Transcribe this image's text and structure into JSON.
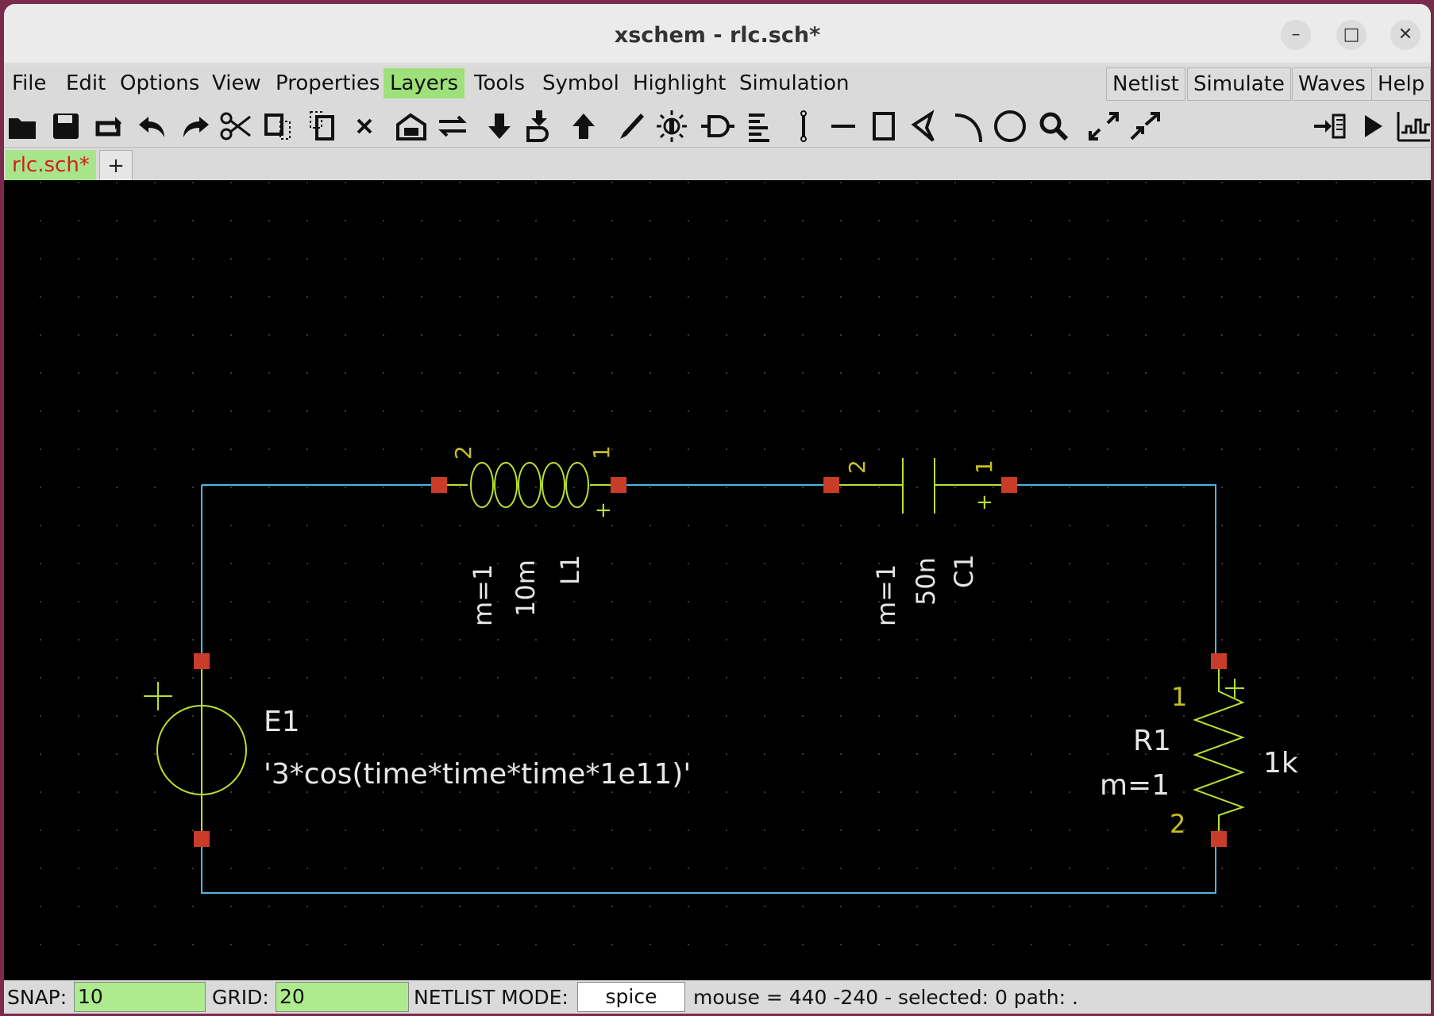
{
  "window": {
    "title": "xschem - rlc.sch*"
  },
  "menubar": {
    "items": [
      "File",
      "Edit",
      "Options",
      "View",
      "Properties",
      "Layers",
      "Tools",
      "Symbol",
      "Highlight",
      "Simulation"
    ],
    "active": "Layers",
    "right_items": [
      "Netlist",
      "Simulate",
      "Waves",
      "Help"
    ]
  },
  "toolbar": {
    "icons": [
      "open-icon",
      "save-icon",
      "reload-icon",
      "undo-icon",
      "redo-icon",
      "cut-icon",
      "copy-icon",
      "move-icon",
      "delete-icon",
      "insert-symbol-icon",
      "flip-icon",
      "descend-icon",
      "descend-symbol-icon",
      "go-up-icon",
      "draw-icon",
      "toggle-colorscheme-icon",
      "insert-pin-icon",
      "netlabel-icon",
      "wire-icon",
      "line-icon",
      "rect-icon",
      "polygon-icon",
      "arc-icon",
      "circle-icon",
      "zoom-icon",
      "zoom-in-icon",
      "zoom-out-icon",
      "netlist-icon",
      "simulate-icon",
      "waves-icon"
    ]
  },
  "tabs": {
    "active": "rlc.sch*",
    "add": "+"
  },
  "schematic": {
    "inductor": {
      "name": "L1",
      "value": "10m",
      "mult": "m=1",
      "pin_left": "2",
      "pin_right": "1",
      "plus": "+"
    },
    "capacitor": {
      "name": "C1",
      "value": "50n",
      "mult": "m=1",
      "pin_left": "2",
      "pin_right": "1",
      "plus": "+"
    },
    "source": {
      "name": "E1",
      "value": "'3*cos(time*time*time*1e11)'",
      "plus": "+"
    },
    "resistor": {
      "name": "R1",
      "value": "1k",
      "mult": "m=1",
      "pin_top": "1",
      "pin_bottom": "2",
      "plus": "+"
    },
    "colors": {
      "wire": "#48b8e0",
      "symbol": "#b8e030",
      "pin": "#c83c28",
      "pin_number": "#c8c020",
      "text": "#e6e6e6",
      "grid": "#303030"
    }
  },
  "status": {
    "snap_label": "SNAP:",
    "snap_value": "10",
    "grid_label": "GRID:",
    "grid_value": "20",
    "netlist_label": "NETLIST MODE:",
    "netlist_value": "spice",
    "info": "mouse = 440 -240 - selected: 0 path: ."
  }
}
